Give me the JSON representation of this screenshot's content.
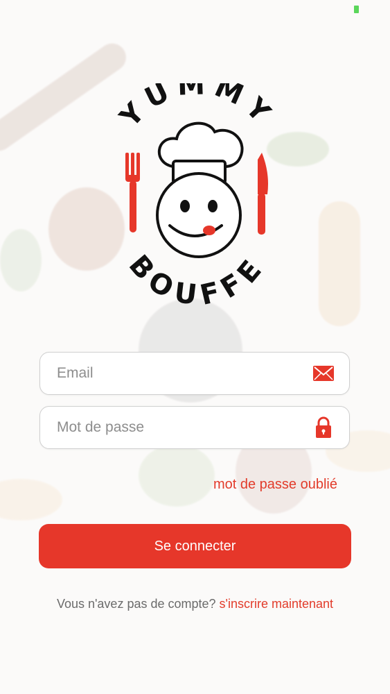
{
  "brand": {
    "name_top": "YUMMY",
    "name_bottom": "BOUFFE",
    "accent": "#e6372a"
  },
  "form": {
    "email_placeholder": "Email",
    "password_placeholder": "Mot de passe",
    "email_icon": "envelope-icon",
    "password_icon": "lock-icon"
  },
  "forgot_label": "mot de passe oublié",
  "login_button_label": "Se connecter",
  "signup": {
    "prompt": "Vous n'avez pas de compte?",
    "link": "s'inscrire maintenant"
  }
}
